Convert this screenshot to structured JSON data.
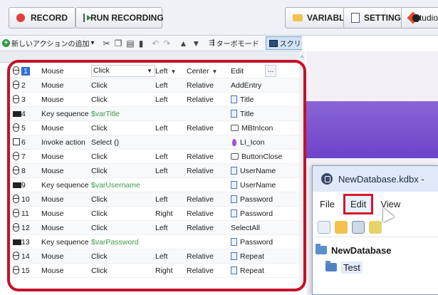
{
  "toolbar": {
    "record_label": "RECORD",
    "run_label": "RUN RECORDING",
    "variables_label": "VARIABLES...",
    "settings_label": "SETTINGS...",
    "studio_label": "Studio"
  },
  "subtoolbar": {
    "add_action_label": "新しいアクションの追加",
    "cut_icon": "scissors-icon",
    "copy_icon": "copy-icon",
    "paste_icon": "paste-icon",
    "delete_icon": "trash-icon",
    "undo_icon": "undo-icon",
    "redo_icon": "redo-icon",
    "up_icon": "arrow-up-icon",
    "down_icon": "arrow-down-icon",
    "turbo_label": "ターボモード",
    "screenshot_label": "スクリーンショット"
  },
  "actions": [
    {
      "icon": "mouse-icon",
      "num": "1",
      "type": "Mouse",
      "action": "Click",
      "button": "Left",
      "position": "Center",
      "target_icon": "tree-icon",
      "target": "Edit",
      "selected": true
    },
    {
      "icon": "mouse-icon",
      "num": "2",
      "type": "Mouse",
      "action": "Click",
      "button": "Left",
      "position": "Relative",
      "target_icon": "tree-icon",
      "target": "AddEntry"
    },
    {
      "icon": "mouse-icon",
      "num": "3",
      "type": "Mouse",
      "action": "Click",
      "button": "Left",
      "position": "Relative",
      "target_icon": "doc-icon",
      "target": "Title"
    },
    {
      "icon": "keyboard-icon",
      "num": "4",
      "type": "Key sequence",
      "action": "$varTitle",
      "button": "",
      "position": "",
      "target_icon": "doc-icon",
      "target": "Title",
      "var": true
    },
    {
      "icon": "mouse-icon",
      "num": "5",
      "type": "Mouse",
      "action": "Click",
      "button": "Left",
      "position": "Relative",
      "target_icon": "ab-icon",
      "target": "MBtnIcon"
    },
    {
      "icon": "invoke-icon",
      "num": "6",
      "type": "Invoke action",
      "action": "Select ()",
      "button": "",
      "position": "",
      "target_icon": "pin-icon",
      "target": "LI_Icon"
    },
    {
      "icon": "mouse-icon",
      "num": "7",
      "type": "Mouse",
      "action": "Click",
      "button": "Left",
      "position": "Relative",
      "target_icon": "ab-icon",
      "target": "ButtonClose"
    },
    {
      "icon": "mouse-icon",
      "num": "8",
      "type": "Mouse",
      "action": "Click",
      "button": "Left",
      "position": "Relative",
      "target_icon": "doc-icon",
      "target": "UserName"
    },
    {
      "icon": "keyboard-icon",
      "num": "9",
      "type": "Key sequence",
      "action": "$varUsername",
      "button": "",
      "position": "",
      "target_icon": "doc-icon",
      "target": "UserName",
      "var": true
    },
    {
      "icon": "mouse-icon",
      "num": "10",
      "type": "Mouse",
      "action": "Click",
      "button": "Left",
      "position": "Relative",
      "target_icon": "doc-icon",
      "target": "Password"
    },
    {
      "icon": "mouse-icon",
      "num": "11",
      "type": "Mouse",
      "action": "Click",
      "button": "Right",
      "position": "Relative",
      "target_icon": "doc-icon",
      "target": "Password"
    },
    {
      "icon": "mouse-icon",
      "num": "12",
      "type": "Mouse",
      "action": "Click",
      "button": "Left",
      "position": "Relative",
      "target_icon": "tree-icon",
      "target": "SelectAll"
    },
    {
      "icon": "keyboard-icon",
      "num": "13",
      "type": "Key sequence",
      "action": "$varPassword",
      "button": "",
      "position": "",
      "target_icon": "doc-icon",
      "target": "Password",
      "var": true
    },
    {
      "icon": "mouse-icon",
      "num": "14",
      "type": "Mouse",
      "action": "Click",
      "button": "Left",
      "position": "Relative",
      "target_icon": "doc-icon",
      "target": "Repeat"
    },
    {
      "icon": "mouse-icon",
      "num": "15",
      "type": "Mouse",
      "action": "Click",
      "button": "Right",
      "position": "Relative",
      "target_icon": "doc-icon",
      "target": "Repeat"
    }
  ],
  "app_window": {
    "title": "NewDatabase.kdbx -",
    "menu": [
      "File",
      "Edit",
      "View"
    ],
    "tree_root": "NewDatabase",
    "tree_child": "Test"
  },
  "colors": {
    "highlight_frame": "#c4122a",
    "variable_text": "#3b9b4b",
    "selection": "#2f6fd0"
  }
}
